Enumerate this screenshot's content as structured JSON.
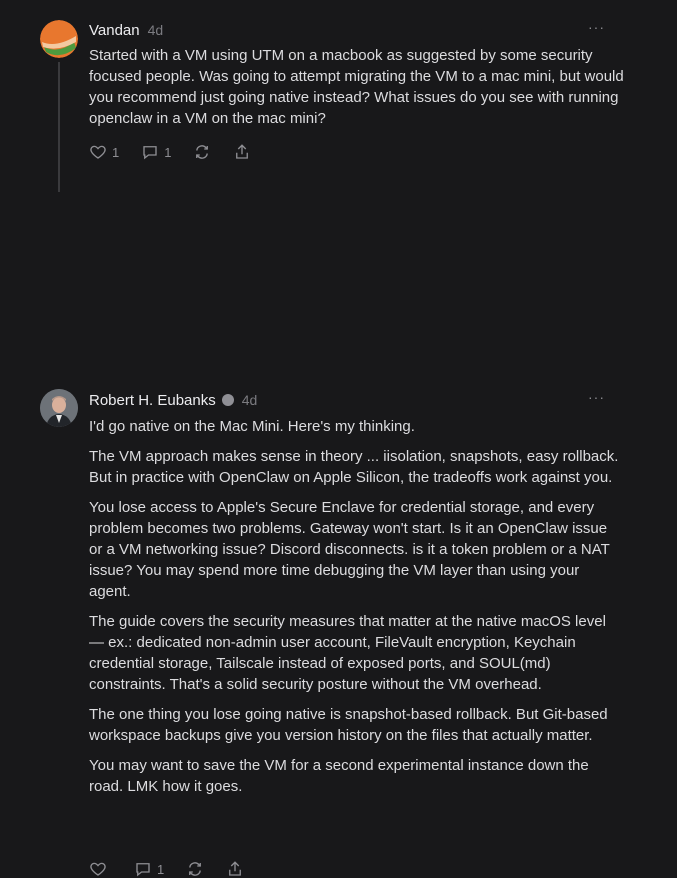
{
  "comments": [
    {
      "author": "Vandan",
      "time": "4d",
      "more": "···",
      "paragraphs": [
        "Started with a VM using UTM on a macbook as suggested by some security focused people. Was going to attempt migrating the VM to a mac mini, but would you recommend just going native instead? What issues do you see with running openclaw in a VM on the mac mini?"
      ],
      "likes": "1",
      "replies": "1"
    },
    {
      "author": "Robert H. Eubanks",
      "time": "4d",
      "more": "···",
      "paragraphs": [
        "I'd go native on the Mac Mini. Here's my thinking.",
        "The VM approach makes sense in theory ... iisolation, snapshots, easy rollback. But in practice with OpenClaw on Apple Silicon, the tradeoffs work against you.",
        "You lose access to Apple's Secure Enclave for credential storage, and every problem becomes two problems. Gateway won't start. Is it an OpenClaw issue or a VM networking issue? Discord disconnects. is it a token problem or a NAT issue? You may spend more time debugging the VM layer than using your agent.",
        "The guide covers the security measures that matter at the native macOS level — ex.: dedicated non-admin user account, FileVault encryption, Keychain credential storage, Tailscale instead of exposed ports, and SOUL(md) constraints. That's a solid security posture without the VM overhead.",
        "The one thing you lose going native is snapshot-based rollback. But Git-based workspace backups give you version history on the files that actually matter.",
        "You may want to save the VM for a second experimental instance down the road. LMK how it goes."
      ],
      "likes": "",
      "replies": "1"
    }
  ]
}
